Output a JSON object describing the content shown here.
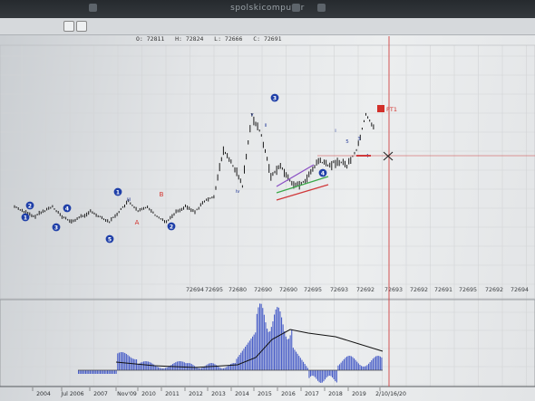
{
  "window": {
    "title": "spolskicomputer"
  },
  "ohlc": {
    "open_label": "O:",
    "open": "72811",
    "high_label": "H:",
    "high": "72824",
    "low_label": "L:",
    "low": "72666",
    "close_label": "C:",
    "close": "72691"
  },
  "price_labels": [
    "72694",
    "72695",
    "72680",
    "72690",
    "72690",
    "72695",
    "72693",
    "72692",
    "72693",
    "72692",
    "72691",
    "72695",
    "72692",
    "72694"
  ],
  "year_labels": [
    "2004",
    "Jul 2006",
    "2007",
    "Nov'09",
    "2010",
    "2011",
    "2012",
    "2013",
    "2014",
    "2015",
    "2016",
    "2017",
    "2018",
    "2019",
    "2/10/16/20"
  ],
  "wave_circles": [
    "1",
    "2",
    "3",
    "4",
    "5",
    "1",
    "2",
    "3",
    "4"
  ],
  "wave_letters": [
    "A",
    "B"
  ],
  "wave_small_text": [
    "iii",
    "iv",
    "v",
    "ii",
    "i",
    "5",
    "3",
    "4"
  ],
  "price_marker": "PT1",
  "colors": {
    "bars": "#1a1a1a",
    "wave_circle": "#1f3fa8",
    "letters_red": "#d2302a",
    "crosshair": "#d04040",
    "histogram": "#4a5fc8",
    "signal_line": "#111111",
    "grid": "#d2d4d6",
    "trend_purple": "#8a4fc4",
    "trend_green": "#3ca84a",
    "trend_red": "#d0383a"
  },
  "chart_data": {
    "type": "line",
    "title": "",
    "series": [
      {
        "values": [
          72694,
          72693,
          72692,
          72693,
          72694,
          72692,
          72691,
          72692,
          72693,
          72692,
          72691,
          72693,
          72695,
          72693,
          72694,
          72692,
          72691,
          72693,
          72694,
          72693,
          72695,
          72696,
          72705,
          72702,
          72698,
          72712,
          72708,
          72700,
          72702,
          72699,
          72698,
          72700,
          72703,
          72702,
          72703,
          72702,
          72705,
          72712,
          72709
        ]
      }
    ],
    "grid": true
  }
}
